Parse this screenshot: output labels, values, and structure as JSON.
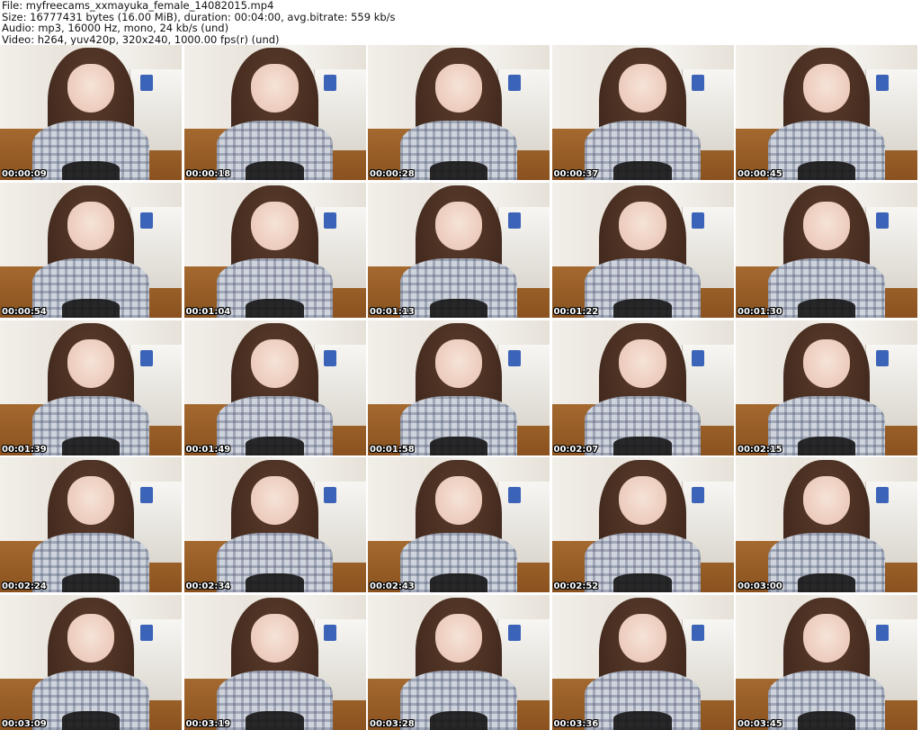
{
  "header": {
    "file": "File: myfreecams_xxmayuka_female_14082015.mp4",
    "size": "Size: 16777431 bytes (16.00 MiB), duration: 00:04:00, avg.bitrate: 559 kb/s",
    "audio": "Audio: mp3, 16000 Hz, mono, 24 kb/s (und)",
    "video": "Video: h264, yuv420p, 320x240, 1000.00 fps(r) (und)"
  },
  "thumbnails": [
    "00:00:09",
    "00:00:18",
    "00:00:28",
    "00:00:37",
    "00:00:45",
    "00:00:54",
    "00:01:04",
    "00:01:13",
    "00:01:22",
    "00:01:30",
    "00:01:39",
    "00:01:49",
    "00:01:58",
    "00:02:07",
    "00:02:15",
    "00:02:24",
    "00:02:34",
    "00:02:43",
    "00:02:52",
    "00:03:00",
    "00:03:09",
    "00:03:19",
    "00:03:28",
    "00:03:36",
    "00:03:45"
  ]
}
